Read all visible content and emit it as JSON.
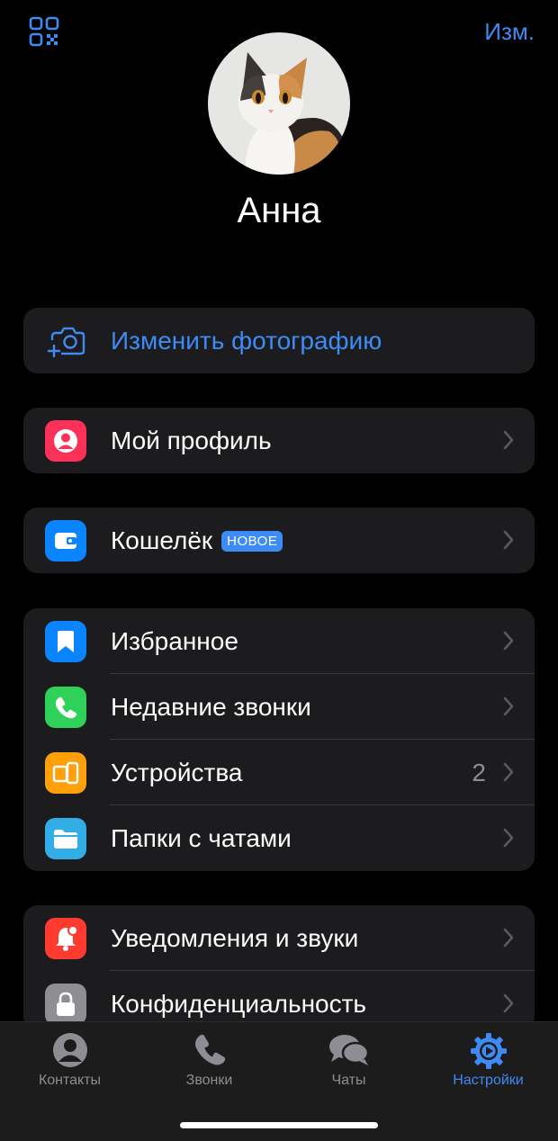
{
  "header": {
    "edit_label": "Изм.",
    "qr_icon": "qr-code-icon"
  },
  "profile": {
    "name": "Анна",
    "avatar": "cat-photo-avatar"
  },
  "change_photo": {
    "label": "Изменить фотографию",
    "icon": "camera-add-icon"
  },
  "menu": {
    "my_profile": {
      "label": "Мой профиль",
      "icon": "person-icon",
      "color": "#fc3158"
    },
    "wallet": {
      "label": "Кошелёк",
      "badge": "НОВОЕ",
      "icon": "wallet-icon",
      "color": "#0a84ff"
    },
    "favorites": {
      "label": "Избранное",
      "icon": "bookmark-icon",
      "color": "#0a84ff"
    },
    "recent_calls": {
      "label": "Недавние звонки",
      "icon": "phone-icon",
      "color": "#30d158"
    },
    "devices": {
      "label": "Устройства",
      "value": "2",
      "icon": "devices-icon",
      "color": "#ff9f0a"
    },
    "chat_folders": {
      "label": "Папки с чатами",
      "icon": "folder-icon",
      "color": "#32ade6"
    },
    "notifications": {
      "label": "Уведомления и звуки",
      "icon": "bell-icon",
      "color": "#ff3b30"
    },
    "privacy": {
      "label": "Конфиденциальность",
      "icon": "lock-icon",
      "color": "#8e8e93"
    }
  },
  "tabs": [
    {
      "label": "Контакты",
      "icon": "contacts-icon",
      "active": false
    },
    {
      "label": "Звонки",
      "icon": "phone-icon",
      "active": false
    },
    {
      "label": "Чаты",
      "icon": "chats-icon",
      "active": false
    },
    {
      "label": "Настройки",
      "icon": "settings-icon",
      "active": true
    }
  ],
  "colors": {
    "accent": "#3e8bf5",
    "background": "#000000",
    "cell": "#1c1c1e",
    "secondary_text": "#8d8d93"
  }
}
